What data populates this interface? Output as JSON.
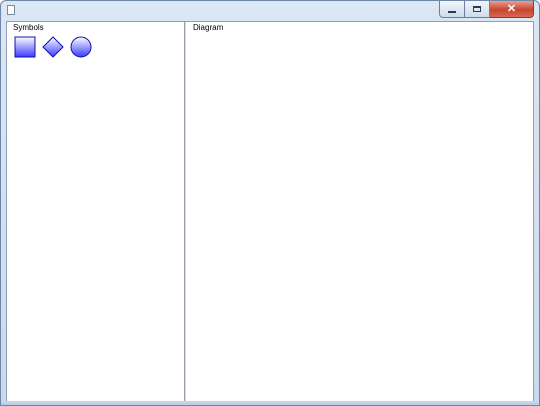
{
  "window": {
    "title": "",
    "caption_buttons": [
      {
        "name": "minimize",
        "icon": "minimize-icon"
      },
      {
        "name": "maximize",
        "icon": "maximize-icon"
      },
      {
        "name": "close",
        "icon": "close-icon",
        "glyph": "✕"
      }
    ]
  },
  "symbols_panel": {
    "header": "Symbols",
    "items": [
      {
        "name": "square",
        "icon": "square-symbol-icon"
      },
      {
        "name": "diamond",
        "icon": "diamond-symbol-icon"
      },
      {
        "name": "circle",
        "icon": "circle-symbol-icon"
      }
    ],
    "symbol_fill_top": "#ffffff",
    "symbol_fill_bottom": "#3a3aff",
    "symbol_stroke": "#1010a8"
  },
  "diagram_panel": {
    "header": "Diagram"
  }
}
